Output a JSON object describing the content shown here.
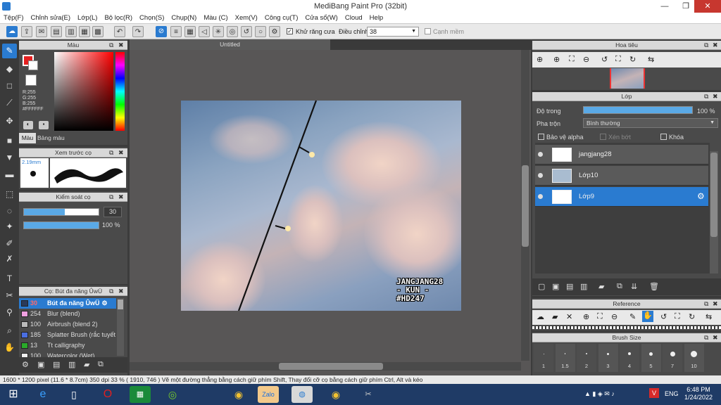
{
  "window": {
    "title": "MediBang Paint Pro (32bit)",
    "min": "—",
    "max": "❐",
    "close": "✕"
  },
  "menu": [
    "Tệp(F)",
    "Chỉnh sửa(E)",
    "Lớp(L)",
    "Bộ lọc(R)",
    "Chọn(S)",
    "Chụp(N)",
    "Màu (C)",
    "Xem(V)",
    "Công cụ(T)",
    "Cửa sổ(W)",
    "Cloud",
    "Help"
  ],
  "toolbar": {
    "antialias_label": "Khử răng cưa",
    "correction_label": "Điều chỉnh",
    "correction_value": "38",
    "soft_label": "Cạnh mềm"
  },
  "color_panel": {
    "title": "Màu",
    "r": "R:255",
    "g": "G:255",
    "b": "B:255",
    "hex": "#FFFFFF",
    "tab_color": "Màu",
    "tab_palette": "Bảng màu"
  },
  "brush_preview": {
    "title": "Xem trước cọ",
    "size": "2.19mm"
  },
  "brush_control": {
    "title": "Kiểm soát cọ",
    "size_value": "30",
    "opacity_value": "100 %",
    "size_fraction": 0.55,
    "opacity_fraction": 1.0
  },
  "brush_panel": {
    "title": "Cọ: Bút đa năng ÛwÜ",
    "items": [
      {
        "size": "30",
        "name": "Bút đa năng ÛwÜ",
        "color": "#2a3a5a",
        "selected": true
      },
      {
        "size": "254",
        "name": "Blur (blend)",
        "color": "#f0a0e0"
      },
      {
        "size": "100",
        "name": "Airbrush (blend 2)",
        "color": "#bbbbbb"
      },
      {
        "size": "185",
        "name": "Splatter Brush (rắc tuyết",
        "color": "#4a6ee0"
      },
      {
        "size": "13",
        "name": "Tt calligraphy",
        "color": "#2aaa2a"
      },
      {
        "size": "100",
        "name": "Watercolor (Wet)",
        "color": "#eeeeee"
      }
    ]
  },
  "canvas": {
    "tab_title": "Untitled",
    "watermark": [
      "JANGJANG28",
      "- KUN -",
      "#HD247"
    ]
  },
  "navigator": {
    "title": "Hoa tiêu"
  },
  "layer_panel": {
    "title": "Lớp",
    "opacity_label": "Độ trong",
    "opacity_value": "100 %",
    "opacity_fraction": 1.0,
    "blend_label": "Pha trộn",
    "blend_value": "Bình thường",
    "protect_alpha": "Bảo vệ alpha",
    "clipping": "Xén bớt",
    "lock": "Khóa",
    "layers": [
      {
        "name": "jangjang28"
      },
      {
        "name": "Lớp10"
      },
      {
        "name": "Lớp9",
        "selected": true
      }
    ]
  },
  "reference": {
    "title": "Reference"
  },
  "brush_size": {
    "title": "Brush Size",
    "sizes": [
      "1",
      "1.5",
      "2",
      "3",
      "4",
      "5",
      "7",
      "10"
    ]
  },
  "status": {
    "text": "1600 * 1200 pixel  (11.6 * 8.7cm)  350 dpi  33 %  ( 1910, 746 )  Vẽ một đường thẳng bằng cách giữ phím Shift, Thay đổi cỡ cọ bằng cách giữ phím Ctrl, Alt và kéo"
  },
  "taskbar": {
    "lang": "ENG",
    "time": "6:48 PM",
    "date": "1/24/2022"
  }
}
